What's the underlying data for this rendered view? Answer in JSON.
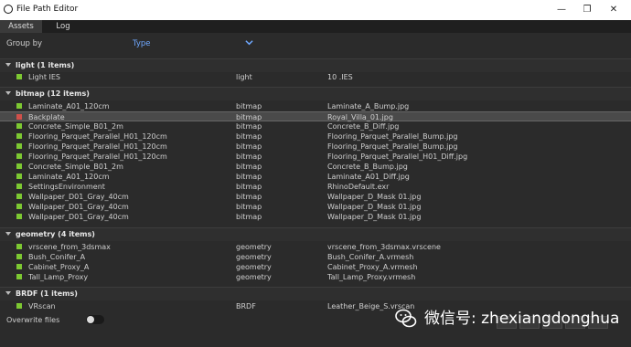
{
  "window": {
    "title": "File Path Editor",
    "controls": {
      "minimize": "—",
      "maximize": "❐",
      "close": "✕"
    }
  },
  "tabs": [
    {
      "label": "Assets",
      "active": true
    },
    {
      "label": "Log",
      "active": false
    }
  ],
  "groupby": {
    "label": "Group by",
    "value": "Type"
  },
  "sections": [
    {
      "header": "light (1 items)",
      "rows": [
        {
          "name": "Light IES",
          "type": "light",
          "file": "10 .IES",
          "status": "ok"
        }
      ]
    },
    {
      "header": "bitmap (12 items)",
      "rows": [
        {
          "name": "Laminate_A01_120cm",
          "type": "bitmap",
          "file": "Laminate_A_Bump.jpg",
          "status": "ok"
        },
        {
          "name": "Backplate",
          "type": "bitmap",
          "file": "Royal_Villa_01.jpg",
          "status": "missing",
          "selected": true
        },
        {
          "name": "Concrete_Simple_B01_2m",
          "type": "bitmap",
          "file": "Concrete_B_Diff.jpg",
          "status": "ok"
        },
        {
          "name": "Flooring_Parquet_Parallel_H01_120cm",
          "type": "bitmap",
          "file": "Flooring_Parquet_Parallel_Bump.jpg",
          "status": "ok"
        },
        {
          "name": "Flooring_Parquet_Parallel_H01_120cm",
          "type": "bitmap",
          "file": "Flooring_Parquet_Parallel_Bump.jpg",
          "status": "ok"
        },
        {
          "name": "Flooring_Parquet_Parallel_H01_120cm",
          "type": "bitmap",
          "file": "Flooring_Parquet_Parallel_H01_Diff.jpg",
          "status": "ok"
        },
        {
          "name": "Concrete_Simple_B01_2m",
          "type": "bitmap",
          "file": "Concrete_B_Bump.jpg",
          "status": "ok"
        },
        {
          "name": "Laminate_A01_120cm",
          "type": "bitmap",
          "file": "Laminate_A01_Diff.jpg",
          "status": "ok"
        },
        {
          "name": "SettingsEnvironment",
          "type": "bitmap",
          "file": "RhinoDefault.exr",
          "status": "ok"
        },
        {
          "name": "Wallpaper_D01_Gray_40cm",
          "type": "bitmap",
          "file": "Wallpaper_D_Mask 01.jpg",
          "status": "ok"
        },
        {
          "name": "Wallpaper_D01_Gray_40cm",
          "type": "bitmap",
          "file": "Wallpaper_D_Mask 01.jpg",
          "status": "ok"
        },
        {
          "name": "Wallpaper_D01_Gray_40cm",
          "type": "bitmap",
          "file": "Wallpaper_D_Mask 01.jpg",
          "status": "ok"
        }
      ]
    },
    {
      "header": "geometry (4 items)",
      "rows": [
        {
          "name": "vrscene_from_3dsmax",
          "type": "geometry",
          "file": "vrscene_from_3dsmax.vrscene",
          "status": "ok"
        },
        {
          "name": "Bush_Conifer_A",
          "type": "geometry",
          "file": "Bush_Conifer_A.vrmesh",
          "status": "ok"
        },
        {
          "name": "Cabinet_Proxy_A",
          "type": "geometry",
          "file": "Cabinet_Proxy_A.vrmesh",
          "status": "ok"
        },
        {
          "name": "Tall_Lamp_Proxy",
          "type": "geometry",
          "file": "Tall_Lamp_Proxy.vrmesh",
          "status": "ok"
        }
      ]
    },
    {
      "header": "BRDF (1 items)",
      "rows": [
        {
          "name": "VRscan",
          "type": "BRDF",
          "file": "Leather_Beige_S.vrscan",
          "status": "ok"
        }
      ]
    }
  ],
  "footer": {
    "overwrite_label": "Overwrite files",
    "overwrite_on": false
  },
  "watermark": {
    "text": "微信号: zhexiangdonghua"
  },
  "colors": {
    "ok": "#7dc832",
    "missing": "#d0504a",
    "accent": "#6fa8ff"
  },
  "icons": {
    "app": "vray-logo-icon",
    "dropdown": "chevron-down-icon",
    "section": "caret-down-icon"
  }
}
